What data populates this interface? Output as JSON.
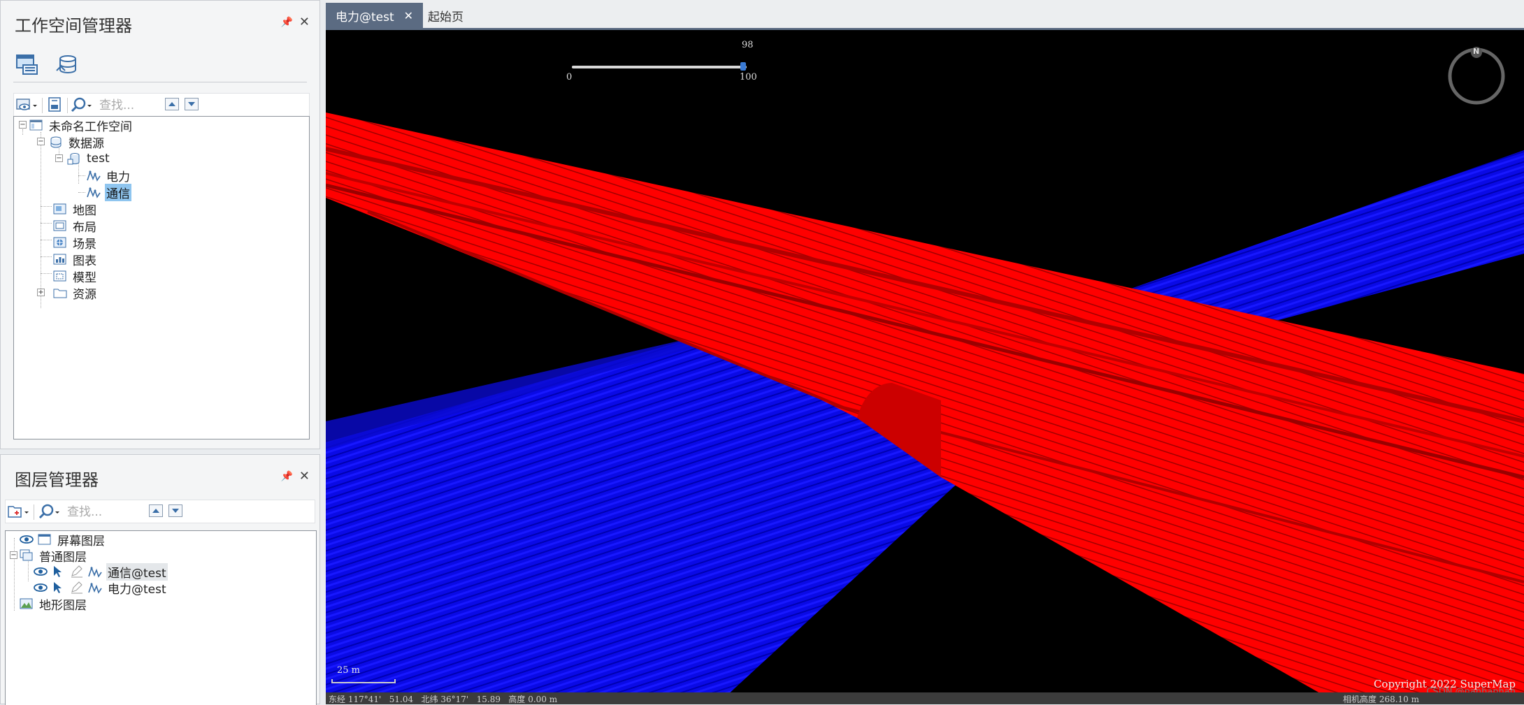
{
  "workspace_panel": {
    "title": "工作空间管理器",
    "search_placeholder": "查找...",
    "tree": {
      "root": "未命名工作空间",
      "datasources": "数据源",
      "datasource_test": "test",
      "dataset_power": "电力",
      "dataset_comm": "通信",
      "maps": "地图",
      "layouts": "布局",
      "scenes": "场景",
      "charts": "图表",
      "models": "模型",
      "resources": "资源"
    }
  },
  "layer_panel": {
    "title": "图层管理器",
    "search_placeholder": "查找...",
    "layers": {
      "screen": "屏幕图层",
      "general": "普通图层",
      "comm_layer": "通信@test",
      "power_layer": "电力@test",
      "terrain": "地形图层"
    }
  },
  "tabs": [
    {
      "label": "电力@test",
      "active": true
    },
    {
      "label": "起始页",
      "active": false
    }
  ],
  "scene": {
    "slider": {
      "value": "98",
      "min": "0",
      "max": "100",
      "fraction": 0.98
    },
    "compass_label": "N",
    "scale_label": "25 m",
    "copyright": "Copyright 2022 SuperMap",
    "watermark": "CSDN @nanhanhan",
    "status_left": "东经 117°41'   51.04   北纬 36°17'   15.89   高度 0.00 m",
    "status_right": "相机高度 268.10 m"
  },
  "colors": {
    "accent": "#5b6b82",
    "pipe_red": "#ff0000",
    "pipe_blue": "#0000ff",
    "selection": "#8fc5ef"
  }
}
